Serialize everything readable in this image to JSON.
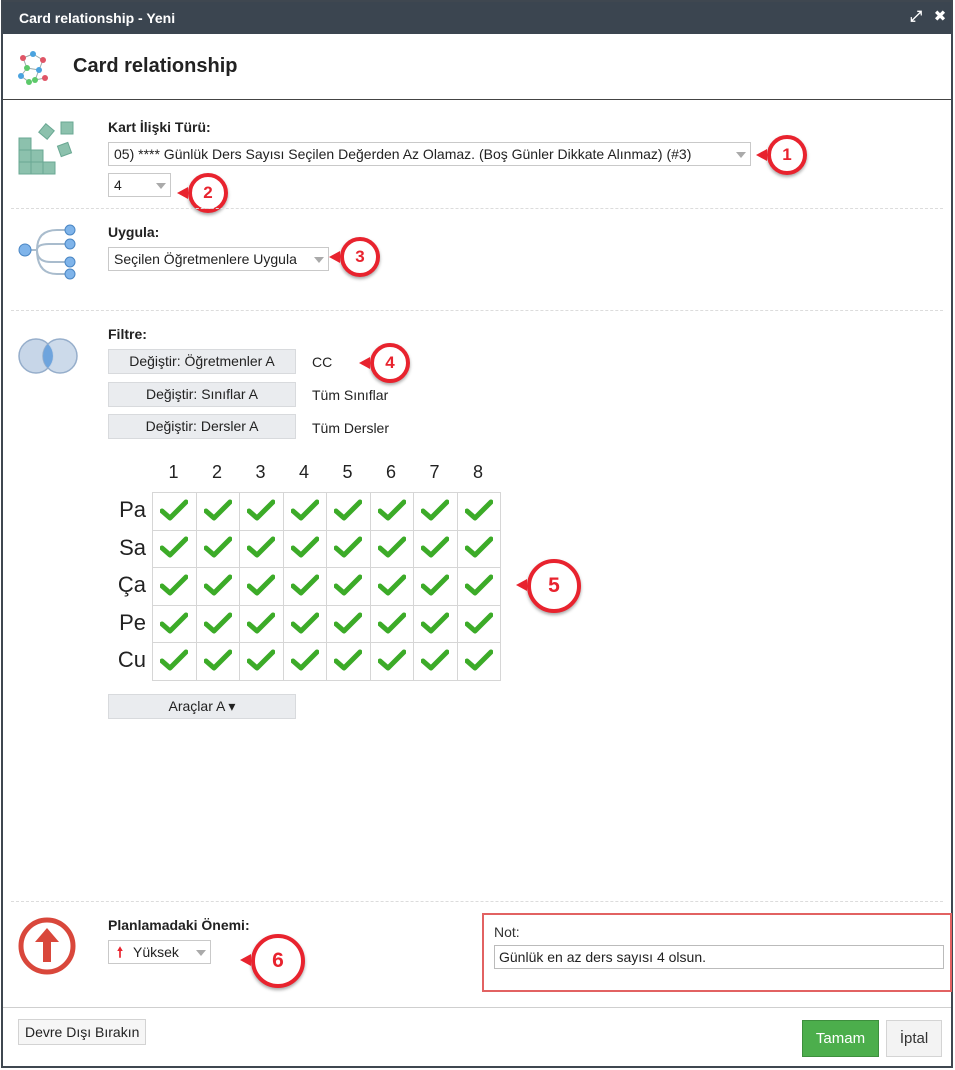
{
  "window": {
    "title": "Card relationship - Yeni",
    "maximize_icon": "maximize-icon",
    "close_icon": "close-icon"
  },
  "header": {
    "title": "Card relationship",
    "icon": "network-graph-icon"
  },
  "relation_type": {
    "label": "Kart İlişki Türü:",
    "value": "05) **** Günlük Ders Sayısı Seçilen Değerden Az Olamaz. (Boş Günler Dikkate Alınmaz) (#3)",
    "number_value": "4",
    "icon": "blocks-icon"
  },
  "apply": {
    "label": "Uygula:",
    "value": "Seçilen Öğretmenlere Uygula",
    "icon": "branch-icon"
  },
  "filter": {
    "label": "Filtre:",
    "icon": "venn-icon",
    "rows": [
      {
        "button": "Değiştir: Öğretmenler A",
        "value": "CC"
      },
      {
        "button": "Değiştir: Sınıflar A",
        "value": "Tüm Sınıflar"
      },
      {
        "button": "Değiştir: Dersler A",
        "value": "Tüm Dersler"
      }
    ]
  },
  "grid": {
    "periods": [
      "1",
      "2",
      "3",
      "4",
      "5",
      "6",
      "7",
      "8"
    ],
    "days": [
      "Pa",
      "Sa",
      "Ça",
      "Pe",
      "Cu"
    ],
    "cell_icon": "checkmark-icon",
    "all_checked": true
  },
  "tools_button": "Araçlar A ▾",
  "importance": {
    "label": "Planlamadaki Önemi:",
    "value": "Yüksek",
    "icon": "arrow-up-icon"
  },
  "note": {
    "label": "Not:",
    "value": "Günlük en az ders sayısı 4 olsun."
  },
  "callouts": [
    "1",
    "2",
    "3",
    "4",
    "5",
    "6"
  ],
  "footer": {
    "disable_button": "Devre Dışı Bırakın",
    "ok_button": "Tamam",
    "cancel_button": "İptal"
  },
  "colors": {
    "titlebar": "#3b4550",
    "callout": "#e8232e",
    "ok": "#4cae4c",
    "check": "#3cab28"
  }
}
